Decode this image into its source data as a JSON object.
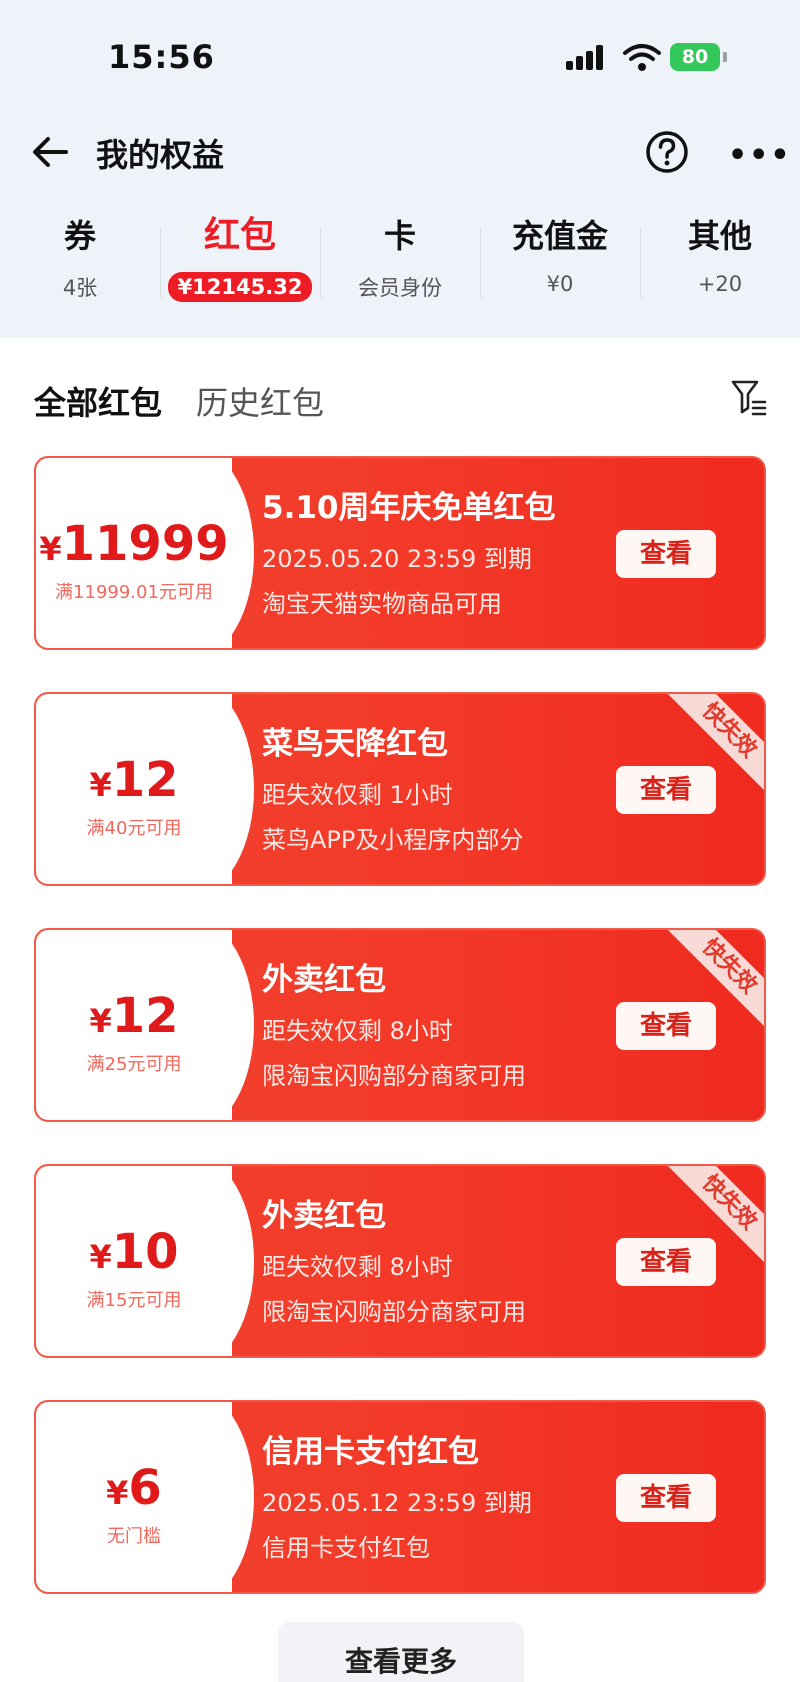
{
  "status_bar": {
    "time": "15:56",
    "battery": "80"
  },
  "nav": {
    "title": "我的权益"
  },
  "tabs": [
    {
      "label": "券",
      "sub": "4张"
    },
    {
      "label": "红包",
      "sub": "¥12145.32",
      "active": true
    },
    {
      "label": "卡",
      "sub": "会员身份"
    },
    {
      "label": "充值金",
      "sub": "¥0"
    },
    {
      "label": "其他",
      "sub": "+20"
    }
  ],
  "filters": {
    "all": "全部红包",
    "history": "历史红包"
  },
  "cards": [
    {
      "currency": "¥",
      "amount": "11999",
      "condition": "满11999.01元可用",
      "title": "5.10周年庆免单红包",
      "line1": "2025.05.20 23:59 到期",
      "line2": "淘宝天猫实物商品可用",
      "button": "查看",
      "badge": ""
    },
    {
      "currency": "¥",
      "amount": "12",
      "condition": "满40元可用",
      "title": "菜鸟天降红包",
      "line1": "距失效仅剩 1小时",
      "line2": "菜鸟APP及小程序内部分",
      "button": "查看",
      "badge": "快失效"
    },
    {
      "currency": "¥",
      "amount": "12",
      "condition": "满25元可用",
      "title": "外卖红包",
      "line1": "距失效仅剩 8小时",
      "line2": "限淘宝闪购部分商家可用",
      "button": "查看",
      "badge": "快失效"
    },
    {
      "currency": "¥",
      "amount": "10",
      "condition": "满15元可用",
      "title": "外卖红包",
      "line1": "距失效仅剩 8小时",
      "line2": "限淘宝闪购部分商家可用",
      "button": "查看",
      "badge": "快失效"
    },
    {
      "currency": "¥",
      "amount": "6",
      "condition": "无门槛",
      "title": "信用卡支付红包",
      "line1": "2025.05.12 23:59 到期",
      "line2": "信用卡支付红包",
      "button": "查看",
      "badge": ""
    }
  ],
  "more_button": "查看更多",
  "colors": {
    "accent": "#ee1c25",
    "card_start": "#f0432f",
    "card_end": "#ef2a1f",
    "badge_bg": "#f7d9d5",
    "battery": "#34c759"
  },
  "icons": [
    "signal-icon",
    "wifi-icon",
    "battery-icon",
    "back-arrow-icon",
    "help-icon",
    "more-icon",
    "filter-icon"
  ]
}
